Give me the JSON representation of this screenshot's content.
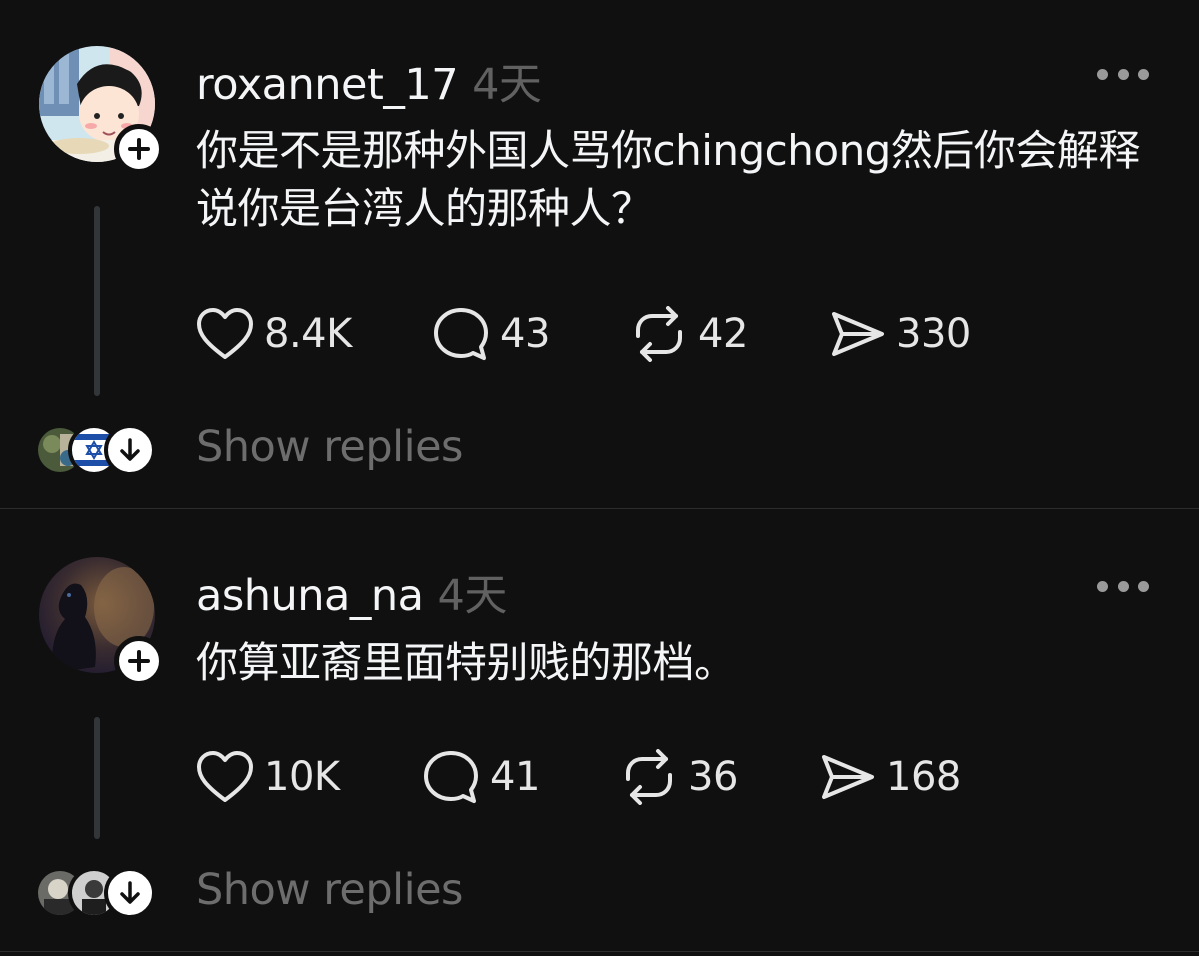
{
  "posts": [
    {
      "username": "roxannet_17",
      "time": "4天",
      "body": "你是不是那种外国人骂你chingchong然后你会解释说你是台湾人的那种人？",
      "likes": "8.4K",
      "comments": "43",
      "reposts": "42",
      "shares": "330",
      "show_replies": "Show replies"
    },
    {
      "username": "ashuna_na",
      "time": "4天",
      "body": "你算亚裔里面特别贱的那档。",
      "likes": "10K",
      "comments": "41",
      "reposts": "36",
      "shares": "168",
      "show_replies": "Show replies"
    }
  ],
  "icons": {
    "like": "heart-icon",
    "comment": "speech-bubble-icon",
    "repost": "repost-icon",
    "share": "send-icon",
    "more": "more-horizontal-icon",
    "follow": "plus-icon",
    "expand": "arrow-down-icon"
  },
  "colors": {
    "background": "#101010",
    "text": "#f3f5f7",
    "muted": "#616161",
    "divider": "#2d2d2d"
  }
}
